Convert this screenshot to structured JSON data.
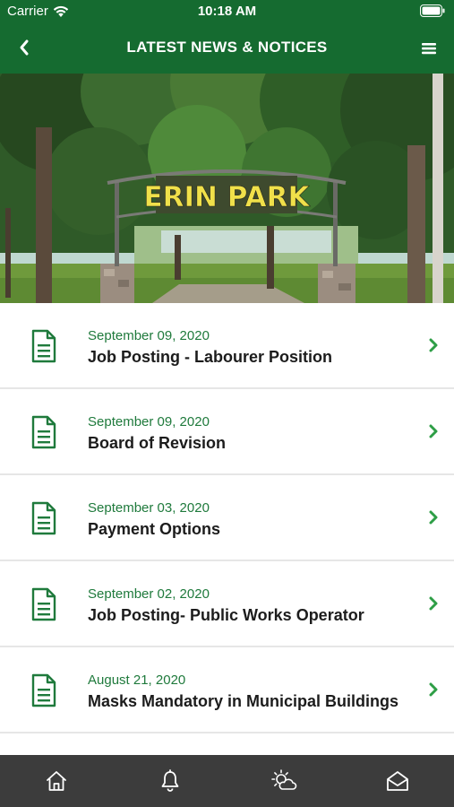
{
  "status_bar": {
    "carrier": "Carrier",
    "time": "10:18 AM"
  },
  "nav": {
    "title": "LATEST NEWS & NOTICES",
    "back_icon": "chevron-left-icon",
    "menu_icon": "hamburger-menu-icon"
  },
  "hero": {
    "sign_text": "ERIN PARK"
  },
  "news": [
    {
      "date": "September 09, 2020",
      "title": "Job Posting - Labourer Position"
    },
    {
      "date": "September 09, 2020",
      "title": "Board of Revision"
    },
    {
      "date": "September 03, 2020",
      "title": "Payment Options"
    },
    {
      "date": "September 02, 2020",
      "title": "Job Posting- Public Works Operator"
    },
    {
      "date": "August 21, 2020",
      "title": "Masks Mandatory in Municipal Buildings"
    }
  ],
  "tabs": [
    {
      "icon": "home-icon"
    },
    {
      "icon": "bell-icon"
    },
    {
      "icon": "weather-icon"
    },
    {
      "icon": "mail-icon"
    }
  ],
  "colors": {
    "brand_green": "#156b30",
    "date_green": "#1f7a3c",
    "chevron_green": "#2e9e46",
    "tab_bar": "#3c3c3c"
  }
}
